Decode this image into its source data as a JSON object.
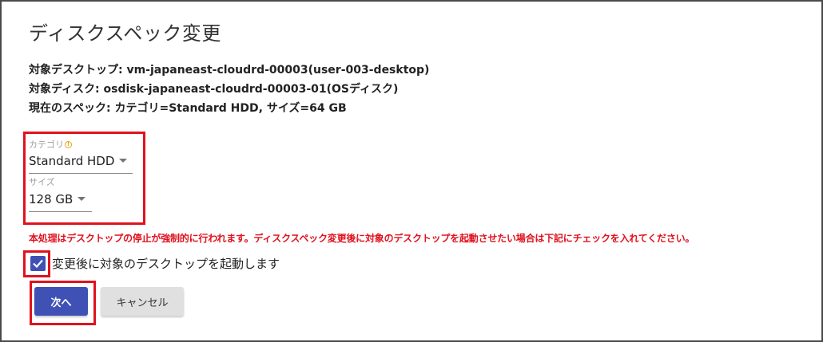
{
  "dialog": {
    "title": "ディスクスペック変更",
    "target_desktop": "対象デスクトップ: vm-japaneast-cloudrd-00003(user-003-desktop)",
    "target_disk": "対象ディスク: osdisk-japaneast-cloudrd-00003-01(OSディスク)",
    "current_spec": "現在のスペック: カテゴリ=Standard HDD, サイズ=64 GB",
    "category": {
      "label": "カテゴリ",
      "value": "Standard HDD",
      "required_icon": "info-circle-icon"
    },
    "size": {
      "label": "サイズ",
      "value": "128 GB"
    },
    "warning": "本処理はデスクトップの停止が強制的に行われます。ディスクスペック変更後に対象のデスクトップを起動させたい場合は下記にチェックを入れてください。",
    "checkbox": {
      "label": "変更後に対象のデスクトップを起動します",
      "checked": true
    },
    "next_button": "次へ",
    "cancel_button": "キャンセル"
  },
  "colors": {
    "accent": "#3f51b5",
    "warning": "#e0121e",
    "highlight_box": "#e0121e"
  }
}
